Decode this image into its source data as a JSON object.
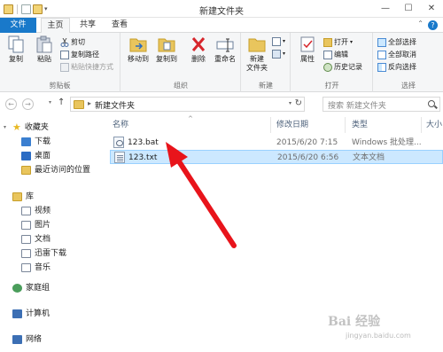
{
  "window": {
    "title": "新建文件夹",
    "minimize": "—",
    "maximize": "☐",
    "close": "✕"
  },
  "tabs": {
    "file": "文件",
    "home": "主页",
    "share": "共享",
    "view": "查看"
  },
  "ribbon": {
    "clipboard": {
      "label": "剪贴板",
      "copy": "复制",
      "paste": "粘贴",
      "cut": "剪切",
      "copy_path": "复制路径",
      "paste_shortcut": "粘贴快捷方式"
    },
    "organize": {
      "label": "组织",
      "move_to": "移动到",
      "copy_to": "复制到",
      "delete": "删除",
      "rename": "重命名"
    },
    "new": {
      "label": "新建",
      "new_folder": "新建\n文件夹"
    },
    "open": {
      "label": "打开",
      "properties": "属性",
      "open": "打开",
      "edit": "编辑",
      "history": "历史记录"
    },
    "select": {
      "label": "选择",
      "select_all": "全部选择",
      "select_none": "全部取消",
      "invert": "反向选择"
    }
  },
  "address": {
    "path": "新建文件夹",
    "separator": "▸",
    "search_placeholder": "搜索 新建文件夹"
  },
  "nav": {
    "favorites": "收藏夹",
    "downloads": "下载",
    "desktop": "桌面",
    "recent": "最近访问的位置",
    "libraries": "库",
    "videos": "视频",
    "pictures": "图片",
    "documents": "文档",
    "thunder": "迅雷下载",
    "music": "音乐",
    "homegroup": "家庭组",
    "computer": "计算机",
    "network": "网络"
  },
  "columns": {
    "name": "名称",
    "date": "修改日期",
    "type": "类型",
    "size": "大小"
  },
  "files": [
    {
      "name": "123.bat",
      "date": "2015/6/20 7:15",
      "type": "Windows 批处理...",
      "size": "",
      "selected": false
    },
    {
      "name": "123.txt",
      "date": "2015/6/20 6:56",
      "type": "文本文档",
      "size": "",
      "selected": true
    }
  ],
  "watermark": {
    "logo": "Bai 经验",
    "url": "jingyan.baidu.com"
  },
  "colors": {
    "accent": "#1979ca",
    "selection": "#cce8ff",
    "annotation_arrow": "#e8141b"
  }
}
